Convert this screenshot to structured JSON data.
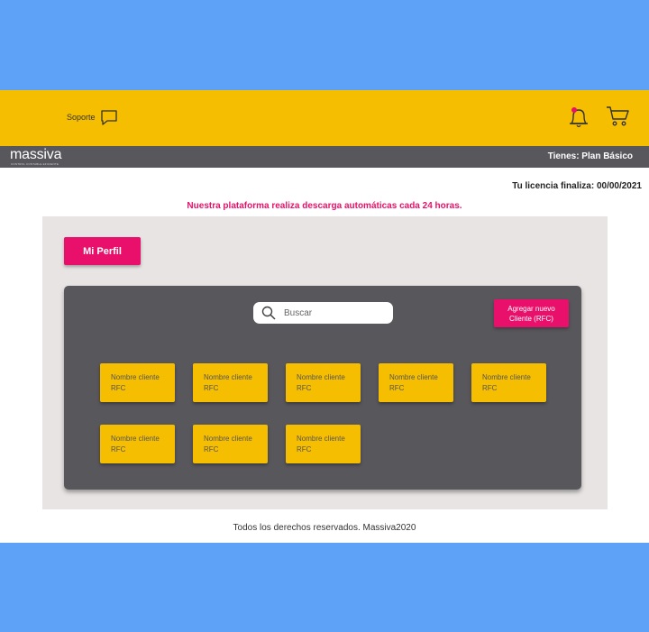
{
  "header": {
    "support_label": "Soporte",
    "icons": [
      "chat-bubble-icon",
      "bell-icon",
      "cart-icon"
    ],
    "notification_dot_color": "#e8106a"
  },
  "brand": {
    "logo": "massiva",
    "tagline": "CONTROL CONTABLE EFICIENTE",
    "plan": "Tienes: Plan Básico"
  },
  "license": "Tu licencia finaliza: 00/00/2021",
  "notice": "Nuestra plataforma realiza descarga automáticas cada 24 horas.",
  "profile_button": "Mi Perfil",
  "search": {
    "placeholder": "Buscar"
  },
  "add_client_button": "Agregar nuevo Cliente (RFC)",
  "clients": [
    {
      "name": "Nombre cliente",
      "rfc": "RFC"
    },
    {
      "name": "Nombre cliente",
      "rfc": "RFC"
    },
    {
      "name": "Nombre cliente",
      "rfc": "RFC"
    },
    {
      "name": "Nombre cliente",
      "rfc": "RFC"
    },
    {
      "name": "Nombre cliente",
      "rfc": "RFC"
    },
    {
      "name": "Nombre cliente",
      "rfc": "RFC"
    },
    {
      "name": "Nombre cliente",
      "rfc": "RFC"
    },
    {
      "name": "Nombre cliente",
      "rfc": "RFC"
    }
  ],
  "footer": "Todos los derechos reservados. Massiva2020",
  "colors": {
    "accent_pink": "#e8106a",
    "brand_yellow": "#f5be00",
    "dark_gray": "#58575c",
    "panel_gray": "#e7e4e3",
    "backdrop_blue": "#5ea2f7"
  }
}
